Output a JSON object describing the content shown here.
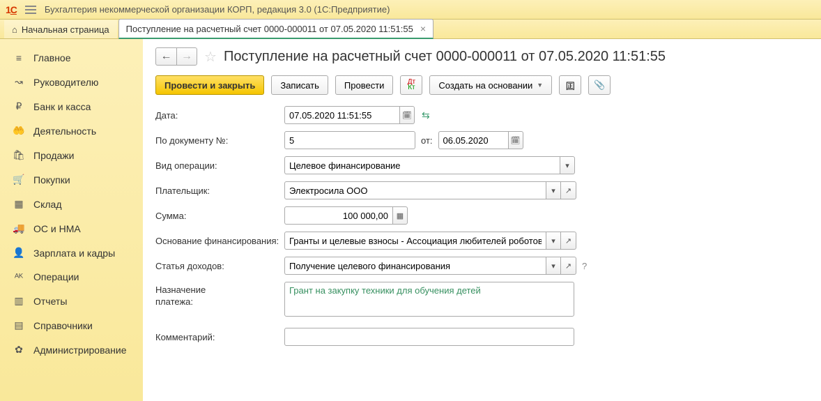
{
  "app": {
    "title": "Бухгалтерия некоммерческой организации КОРП, редакция 3.0  (1С:Предприятие)"
  },
  "tabs": {
    "home": "Начальная страница",
    "active": "Поступление на расчетный счет 0000-000011 от 07.05.2020 11:51:55"
  },
  "sidebar": {
    "items": [
      {
        "icon": "≡",
        "label": "Главное"
      },
      {
        "icon": "↝",
        "label": "Руководителю"
      },
      {
        "icon": "₽",
        "label": "Банк и касса"
      },
      {
        "icon": "🤲",
        "label": "Деятельность"
      },
      {
        "icon": "🛍",
        "label": "Продажи"
      },
      {
        "icon": "🛒",
        "label": "Покупки"
      },
      {
        "icon": "▦",
        "label": "Склад"
      },
      {
        "icon": "🚚",
        "label": "ОС и НМА"
      },
      {
        "icon": "👤",
        "label": "Зарплата и кадры"
      },
      {
        "icon": "ᴬᴷ",
        "label": "Операции"
      },
      {
        "icon": "▥",
        "label": "Отчеты"
      },
      {
        "icon": "▤",
        "label": "Справочники"
      },
      {
        "icon": "✿",
        "label": "Администрирование"
      }
    ]
  },
  "doc": {
    "title": "Поступление на расчетный счет 0000-000011 от 07.05.2020 11:51:55"
  },
  "toolbar": {
    "post_close": "Провести и закрыть",
    "record": "Записать",
    "post": "Провести",
    "create_based": "Создать на основании"
  },
  "form": {
    "date_label": "Дата:",
    "date_value": "07.05.2020 11:51:55",
    "docnum_label": "По документу №:",
    "docnum_value": "5",
    "from_label": "от:",
    "from_value": "06.05.2020",
    "optype_label": "Вид операции:",
    "optype_value": "Целевое финансирование",
    "payer_label": "Плательщик:",
    "payer_value": "Электросила ООО",
    "amount_label": "Сумма:",
    "amount_value": "100 000,00",
    "basis_label": "Основание финансирования:",
    "basis_value": "Гранты и целевые взносы - Ассоциация любителей роботов",
    "income_label": "Статья доходов:",
    "income_value": "Получение целевого финансирования",
    "purpose_label": "Назначение\nплатежа:",
    "purpose_value": "Грант на закупку техники для обучения детей",
    "comment_label": "Комментарий:",
    "comment_value": ""
  }
}
